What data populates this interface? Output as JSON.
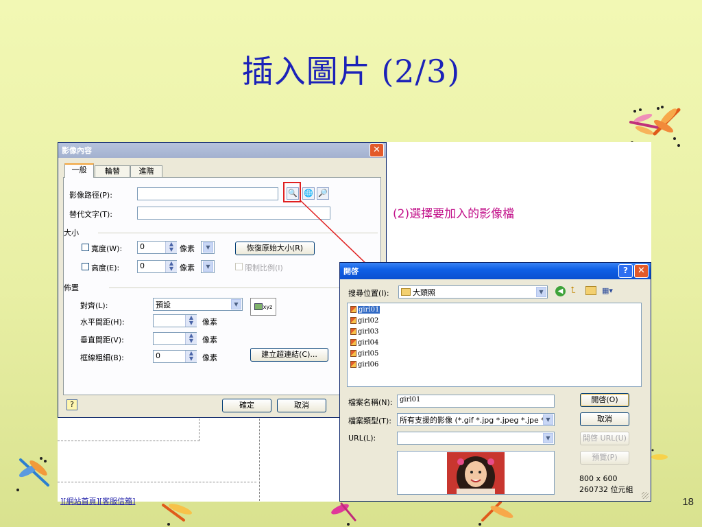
{
  "slide": {
    "title": "插入圖片 (2/3)",
    "page_number": "18",
    "callout": "(2)選擇要加入的影像檔",
    "doc_link": "][網站首頁][客服信箱]"
  },
  "props_dialog": {
    "title": "影像內容",
    "tabs": [
      "一般",
      "輪替",
      "進階"
    ],
    "image_path_label": "影像路徑(P):",
    "alt_text_label": "替代文字(T):",
    "size_group": "大小",
    "width_label": "寬度(W):",
    "width_value": "0",
    "width_unit": "像素",
    "height_label": "高度(E):",
    "height_value": "0",
    "height_unit": "像素",
    "restore_button": "恢復原始大小(R)",
    "lock_ratio_label": "限制比例(I)",
    "layout_group": "佈置",
    "align_label": "對齊(L):",
    "align_value": "預設",
    "preview_text": "xyz",
    "hspace_label": "水平間距(H):",
    "hspace_unit": "像素",
    "vspace_label": "垂直間距(V):",
    "vspace_unit": "像素",
    "border_label": "框線粗細(B):",
    "border_value": "0",
    "border_unit": "像素",
    "create_link_button": "建立超連結(C)...",
    "ok_button": "確定",
    "cancel_button": "取消"
  },
  "open_dialog": {
    "title": "開啓",
    "look_in_label": "搜尋位置(I):",
    "look_in_value": "大頭照",
    "files": [
      "girl01",
      "girl02",
      "girl03",
      "girl04",
      "girl05",
      "girl06"
    ],
    "selected_file": "girl01",
    "filename_label": "檔案名稱(N):",
    "filename_value": "girl01",
    "filetype_label": "檔案類型(T):",
    "filetype_value": "所有支援的影像 (*.gif *.jpg *.jpeg *.jpe *.",
    "url_label": "URL(L):",
    "open_button": "開啓(O)",
    "cancel_button": "取消",
    "open_url_button": "開啓 URL(U)",
    "preview_button": "預覽(P)",
    "image_dimensions": "800 x 600",
    "image_size": "260732 位元組"
  },
  "colors": {
    "title": "#1c22b8",
    "callout": "#c2118a",
    "highlight_box": "#e02020",
    "xp_titlebar": "#0f5fe6"
  }
}
